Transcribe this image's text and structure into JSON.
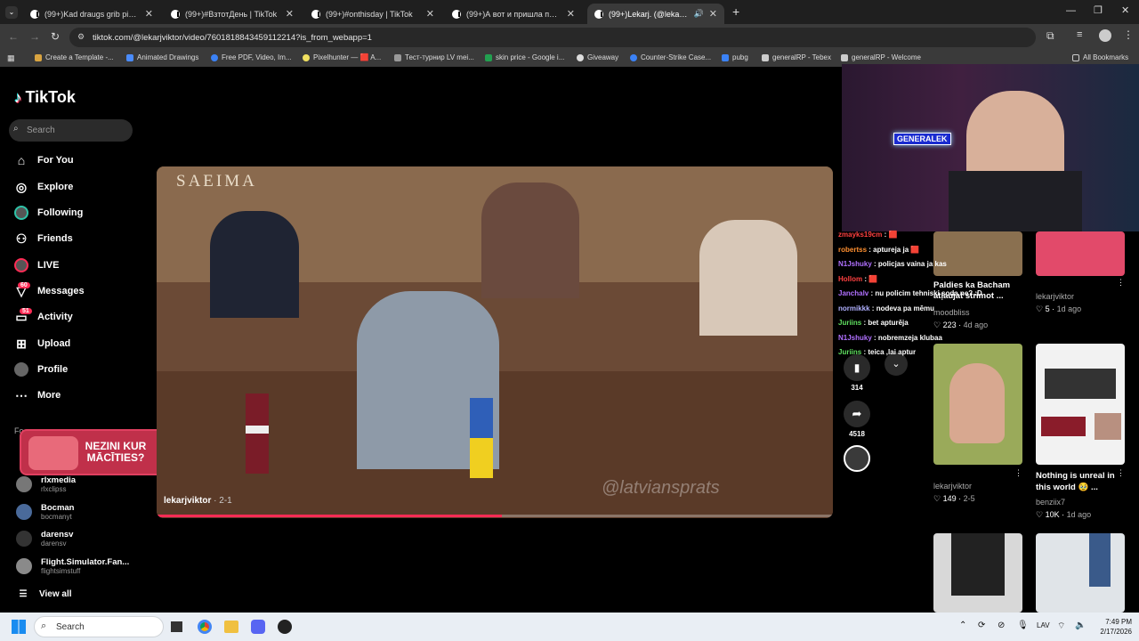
{
  "browser": {
    "tabs": [
      {
        "title": "(99+)Kad draugs grib piebrauk",
        "active": false
      },
      {
        "title": "(99+)#ВзтотДень | TikTok",
        "active": false
      },
      {
        "title": "(99+)#onthisday | TikTok",
        "active": false
      },
      {
        "title": "(99+)А вот и пришла пора тре",
        "active": false
      },
      {
        "title": "(99+)Lekarj. (@lekarjviktor)",
        "active": true
      }
    ],
    "url": "tiktok.com/@lekarjviktor/video/7601818843459112214?is_from_webapp=1",
    "bookmarks": [
      "Create a Template -...",
      "Animated Drawings",
      "Free PDF, Video, Im...",
      "Pixelhunter — 🟥 A...",
      "Тест-турнир LV mei...",
      "skin price - Google i...",
      "Giveaway",
      "Counter-Strike Case...",
      "pubg",
      "generalRP - Tebex",
      "generalRP - Welcome"
    ],
    "all_bookmarks": "All Bookmarks"
  },
  "tiktok": {
    "logo": "TikTok",
    "search_placeholder": "Search",
    "nav": [
      {
        "label": "For You",
        "icon": "home-icon"
      },
      {
        "label": "Explore",
        "icon": "compass-icon"
      },
      {
        "label": "Following",
        "icon": "following-icon"
      },
      {
        "label": "Friends",
        "icon": "friends-icon"
      },
      {
        "label": "LIVE",
        "icon": "live-icon"
      },
      {
        "label": "Messages",
        "icon": "messages-icon",
        "badge": "60"
      },
      {
        "label": "Activity",
        "icon": "activity-icon",
        "badge": "51"
      },
      {
        "label": "Upload",
        "icon": "upload-icon"
      },
      {
        "label": "Profile",
        "icon": "profile-icon"
      },
      {
        "label": "More",
        "icon": "more-icon"
      }
    ],
    "following_heading": "Fo",
    "ad_text": "NEZINI KUR MĀCĪTIES?",
    "accounts": [
      {
        "name": "rlxmedia",
        "handle": "rlxclipss"
      },
      {
        "name": "Bocman",
        "handle": "bocmanyt"
      },
      {
        "name": "darensv",
        "handle": "darensv"
      },
      {
        "name": "Flight.Simulator.Fan...",
        "handle": "flightsimstuff"
      }
    ],
    "view_all": "View all",
    "video": {
      "author": "lekarjviktor",
      "date": "2-1",
      "watermark_top": "SAEIMA",
      "watermark_bottom": "@latviansprats",
      "progress": 0.51
    },
    "actions": {
      "saves": "314",
      "shares": "4518"
    },
    "grid": [
      {
        "title": "Paldies ka Bacham atļaujat strimot ...",
        "author": "moodbliss",
        "likes": "223",
        "age": "4d ago"
      },
      {
        "title": "",
        "author": "lekarjviktor",
        "likes": "5",
        "age": "1d ago"
      },
      {
        "title": "",
        "author": "lekarjviktor",
        "likes": "149",
        "age": "2-5"
      },
      {
        "title": "Nothing is unreal in this world 🥹 ...",
        "author": "benziix7",
        "likes": "10K",
        "age": "1d ago"
      }
    ]
  },
  "stream": {
    "overlay_name": "GENERALEK",
    "chat": [
      {
        "user": "zmayks19cm",
        "msg": "🟥",
        "color": "#ff4040"
      },
      {
        "user": "robertss",
        "msg": "aptureja ja 🟥",
        "color": "#ff9030"
      },
      {
        "user": "N1Jshuky",
        "msg": "policjas vaina ja kas",
        "color": "#b070ff"
      },
      {
        "user": "Hollom",
        "msg": "🟥",
        "color": "#ff4040"
      },
      {
        "user": "Janchalv",
        "msg": "nu policim tehniski soda ne? :D",
        "color": "#b070ff"
      },
      {
        "user": "normikkk",
        "msg": "nodeva pa mēmu",
        "color": "#b0b0ff"
      },
      {
        "user": "Juriins",
        "msg": "bet apturēja",
        "color": "#60e060"
      },
      {
        "user": "N1Jshuky",
        "msg": "nobremzeja klubaa",
        "color": "#b070ff"
      },
      {
        "user": "Juriins",
        "msg": "teica ,lai aptur",
        "color": "#60e060"
      }
    ]
  },
  "taskbar": {
    "search": "Search",
    "lang": "LAV",
    "time": "7:49 PM",
    "date": "2/17/2026"
  }
}
